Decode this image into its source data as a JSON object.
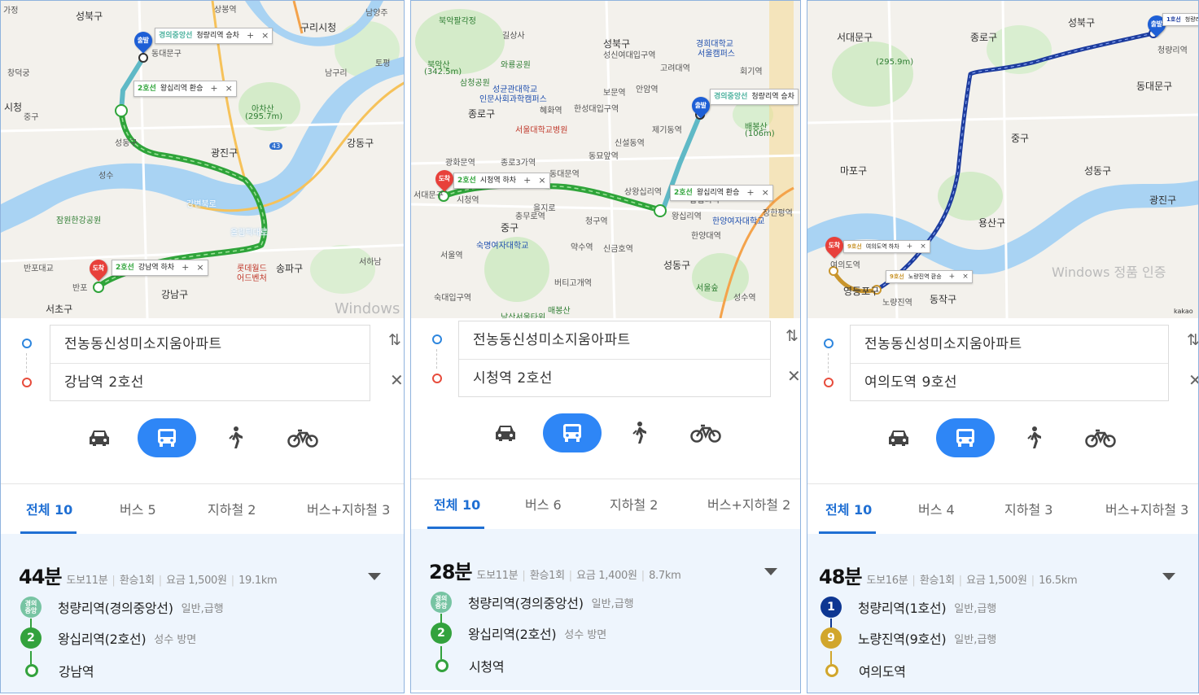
{
  "colors": {
    "accent": "#2e86f6",
    "gyeongui": "#77c4a3",
    "line1": "#0d3692",
    "line2": "#33a23d",
    "line9": "#d1a62c",
    "water": "#a7d3f5",
    "park": "#cfe8c5"
  },
  "icons": [
    "car-icon",
    "bus-icon",
    "walk-icon",
    "bicycle-icon",
    "swap-icon",
    "close-icon",
    "chevron-down-icon"
  ],
  "panels": [
    {
      "map": {
        "labels": [
          "성북구",
          "상봉역",
          "구리시청",
          "남양주",
          "가정",
          "창덕궁",
          "동대문구",
          "남구리",
          "아차산",
          "(295.7m)",
          "시청",
          "중구",
          "광진구",
          "강동구",
          "토평",
          "성동구",
          "성수",
          "잠원한강공원",
          "반포대교",
          "반포",
          "서초구",
          "강남구",
          "송파구",
          "서하남",
          "롯데월드",
          "어드벤처",
          "강변북로",
          "올림픽대로",
          "43"
        ],
        "start_pin": "출발",
        "end_pin": "도착",
        "callouts": [
          {
            "line": "경의중앙선",
            "text": "청량리역 승차"
          },
          {
            "line": "2호선",
            "text": "왕십리역 환승"
          },
          {
            "line": "2호선",
            "text": "강남역 하차"
          }
        ],
        "watermark": "Windows"
      },
      "search": {
        "origin": "전농동신성미소지움아파트",
        "destination": "강남역 2호선"
      },
      "tabs": [
        {
          "label": "전체",
          "count": "10"
        },
        {
          "label": "버스",
          "count": "5"
        },
        {
          "label": "지하철",
          "count": "2"
        },
        {
          "label": "버스+지하철",
          "count": "3"
        }
      ],
      "route": {
        "time": "44분",
        "walk": "도보11분",
        "transfer": "환승1회",
        "fare": "요금 1,500원",
        "distance": "19.1km",
        "steps": [
          {
            "badge": "경의\n중앙",
            "name": "청량리역(경의중앙선)",
            "sub": "일반,급행"
          },
          {
            "badge": "2",
            "name": "왕십리역(2호선)",
            "sub": "성수 방면"
          },
          {
            "badge": "",
            "name": "강남역",
            "sub": ""
          }
        ]
      }
    },
    {
      "map": {
        "labels": [
          "북악팔각정",
          "길상사",
          "북악산",
          "(342.5m)",
          "삼청공원",
          "와룡공원",
          "성균관대학교",
          "인문사회과학캠퍼스",
          "혜화역",
          "한성대입구역",
          "성북구",
          "성신여대입구역",
          "고려대역",
          "경희대학교",
          "서울캠퍼스",
          "회기역",
          "보문역",
          "안암역",
          "종로구",
          "서울대학교병원",
          "신설동역",
          "제기동역",
          "배봉산",
          "(106m)",
          "종로3가역",
          "동묘앞역",
          "동대문역",
          "광화문역",
          "시청역",
          "서대문구",
          "중구",
          "을지로",
          "충무로역",
          "청구역",
          "상왕십리역",
          "왕십리역",
          "한양여자대학교",
          "한양대역",
          "서울역",
          "약수역",
          "신금호역",
          "숙명여자대학교",
          "버티고개역",
          "매봉산",
          "남산서울타워",
          "서울숲",
          "성동구",
          "숙대입구역",
          "답십리역",
          "장한평역",
          "성수역"
        ],
        "start_pin": "출발",
        "end_pin": "도착",
        "callouts": [
          {
            "line": "경의중앙선",
            "text": "청량리역 승차"
          },
          {
            "line": "2호선",
            "text": "시청역 하차"
          },
          {
            "line": "2호선",
            "text": "왕십리역 환승"
          }
        ],
        "watermark": ""
      },
      "search": {
        "origin": "전농동신성미소지움아파트",
        "destination": "시청역 2호선"
      },
      "tabs": [
        {
          "label": "전체",
          "count": "10"
        },
        {
          "label": "버스",
          "count": "6"
        },
        {
          "label": "지하철",
          "count": "2"
        },
        {
          "label": "버스+지하철",
          "count": "2"
        }
      ],
      "route": {
        "time": "28분",
        "walk": "도보11분",
        "transfer": "환승1회",
        "fare": "요금 1,400원",
        "distance": "8.7km",
        "steps": [
          {
            "badge": "경의\n중앙",
            "name": "청량리역(경의중앙선)",
            "sub": "일반,급행"
          },
          {
            "badge": "2",
            "name": "왕십리역(2호선)",
            "sub": "성수 방면"
          },
          {
            "badge": "",
            "name": "시청역",
            "sub": ""
          }
        ]
      }
    },
    {
      "map": {
        "labels": [
          "서대문구",
          "종로구",
          "성북구",
          "동대문구",
          "중구",
          "용산구",
          "성동구",
          "광진구",
          "마포구",
          "영등포구",
          "동작구",
          "여의도역",
          "노량진역",
          "청량리역",
          "(295.9m)",
          "kakao"
        ],
        "start_pin": "출발",
        "end_pin": "도착",
        "callouts": [
          {
            "line": "1호선",
            "text": "청량리역 승차"
          },
          {
            "line": "9호선",
            "text": "여의도역 하차"
          },
          {
            "line": "9호선",
            "text": "노량진역 환승"
          }
        ],
        "watermark": "Windows 정품 인증"
      },
      "search": {
        "origin": "전농동신성미소지움아파트",
        "destination": "여의도역 9호선"
      },
      "tabs": [
        {
          "label": "전체",
          "count": "10"
        },
        {
          "label": "버스",
          "count": "4"
        },
        {
          "label": "지하철",
          "count": "3"
        },
        {
          "label": "버스+지하철",
          "count": "3"
        }
      ],
      "route": {
        "time": "48분",
        "walk": "도보16분",
        "transfer": "환승1회",
        "fare": "요금 1,500원",
        "distance": "16.5km",
        "steps": [
          {
            "badge": "1",
            "name": "청량리역(1호선)",
            "sub": "일반,급행"
          },
          {
            "badge": "9",
            "name": "노량진역(9호선)",
            "sub": "일반,급행"
          },
          {
            "badge": "",
            "name": "여의도역",
            "sub": ""
          }
        ]
      }
    }
  ]
}
